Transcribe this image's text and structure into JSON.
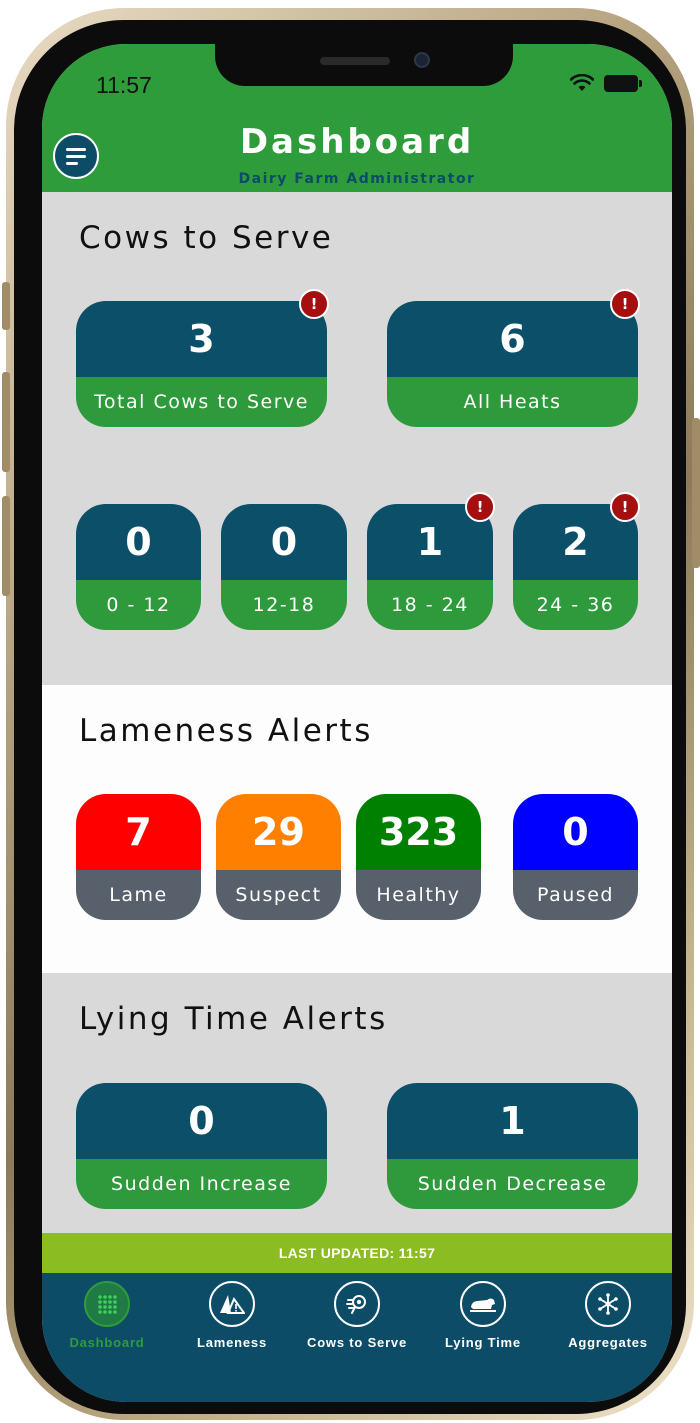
{
  "status": {
    "time": "11:57"
  },
  "header": {
    "title": "Dashboard",
    "subtitle": "Dairy Farm Administrator"
  },
  "cows_to_serve": {
    "title": "Cows to Serve",
    "main": [
      {
        "value": "3",
        "label": "Total Cows to Serve",
        "alert": "!"
      },
      {
        "value": "6",
        "label": "All Heats",
        "alert": "!"
      }
    ],
    "ranges": [
      {
        "value": "0",
        "label": "0 - 12"
      },
      {
        "value": "0",
        "label": "12-18"
      },
      {
        "value": "1",
        "label": "18 - 24",
        "alert": "!"
      },
      {
        "value": "2",
        "label": "24 - 36",
        "alert": "!"
      }
    ]
  },
  "lameness": {
    "title": "Lameness Alerts",
    "cards": [
      {
        "value": "7",
        "label": "Lame",
        "color": "#ff0000"
      },
      {
        "value": "29",
        "label": "Suspect",
        "color": "#ff7f00"
      },
      {
        "value": "323",
        "label": "Healthy",
        "color": "#008000"
      },
      {
        "value": "0",
        "label": "Paused",
        "color": "#0000ff"
      }
    ]
  },
  "lying_time": {
    "title": "Lying Time Alerts",
    "cards": [
      {
        "value": "0",
        "label": "Sudden Increase"
      },
      {
        "value": "1",
        "label": "Sudden Decrease"
      }
    ]
  },
  "last_updated": "LAST UPDATED: 11:57",
  "tabs": [
    {
      "label": "Dashboard",
      "icon": "grid-icon"
    },
    {
      "label": "Lameness",
      "icon": "lameness-icon"
    },
    {
      "label": "Cows to Serve",
      "icon": "cow-serve-icon"
    },
    {
      "label": "Lying Time",
      "icon": "lying-cow-icon"
    },
    {
      "label": "Aggregates",
      "icon": "network-icon"
    }
  ],
  "colors": {
    "header_green": "#2f9c3b",
    "teal": "#0c4f69",
    "alert_red": "#a50f0f",
    "updated_bar": "#8bbd22"
  }
}
